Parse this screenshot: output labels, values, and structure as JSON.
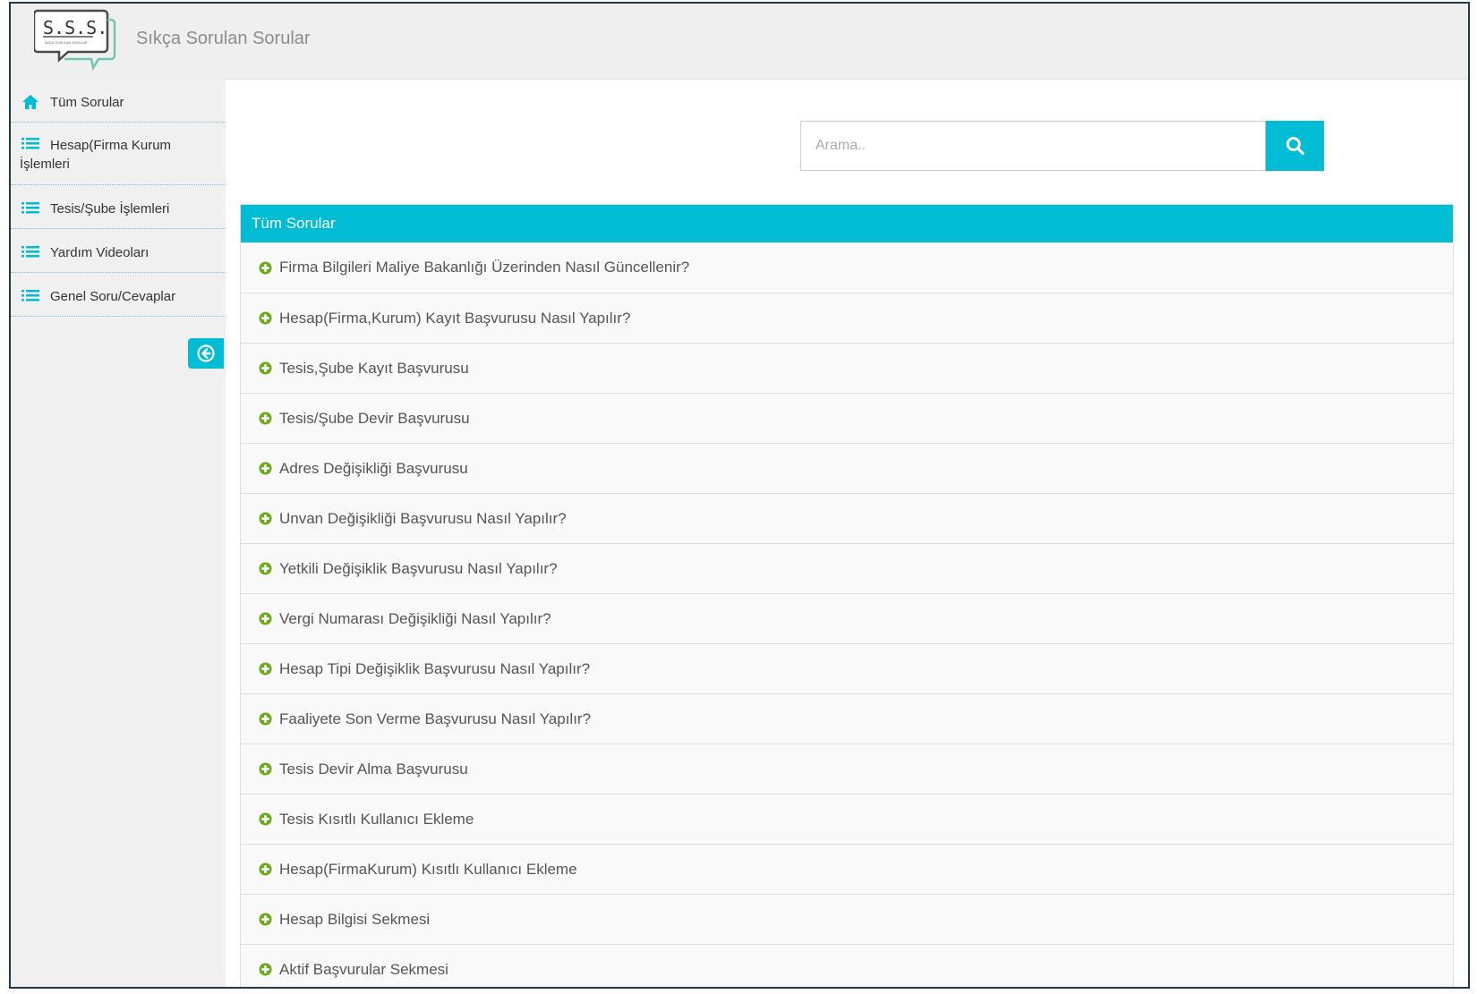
{
  "header": {
    "logo_text": "S.S.S.",
    "logo_subtext": "SIKÇA SORULAN SORULAR",
    "title": "Sıkça Sorulan Sorular"
  },
  "sidebar": {
    "items": [
      {
        "label": "Tüm Sorular",
        "icon": "home-icon"
      },
      {
        "label": "Hesap(Firma Kurum",
        "label2": "İşlemleri",
        "icon": "list-icon"
      },
      {
        "label": "Tesis/Şube İşlemleri",
        "icon": "list-icon"
      },
      {
        "label": "Yardım Videoları",
        "icon": "list-icon"
      },
      {
        "label": "Genel Soru/Cevaplar",
        "icon": "list-icon"
      }
    ],
    "collapse_icon": "arrow-left-circle-icon"
  },
  "search": {
    "placeholder": "Arama..",
    "value": "",
    "icon": "search-icon"
  },
  "panel": {
    "title": "Tüm Sorular",
    "items": [
      "Firma Bilgileri Maliye Bakanlığı Üzerinden Nasıl Güncellenir?",
      "Hesap(Firma,Kurum) Kayıt Başvurusu Nasıl Yapılır?",
      "Tesis,Şube Kayıt Başvurusu",
      "Tesis/Şube Devir Başvurusu",
      "Adres Değişikliği Başvurusu",
      "Unvan Değişikliği Başvurusu Nasıl Yapılır?",
      "Yetkili Değişiklik Başvurusu Nasıl Yapılır?",
      "Vergi Numarası Değişikliği Nasıl Yapılır?",
      "Hesap Tipi Değişiklik Başvurusu Nasıl Yapılır?",
      "Faaliyete Son Verme Başvurusu Nasıl Yapılır?",
      "Tesis Devir Alma Başvurusu",
      "Tesis Kısıtlı Kullanıcı Ekleme",
      "Hesap(FirmaKurum) Kısıtlı Kullanıcı Ekleme",
      "Hesap Bilgisi Sekmesi",
      "Aktif Başvurular Sekmesi"
    ]
  },
  "colors": {
    "accent": "#00bcd4",
    "plus_icon": "#6aaa1e",
    "sidebar_icon": "#00bcd4"
  }
}
